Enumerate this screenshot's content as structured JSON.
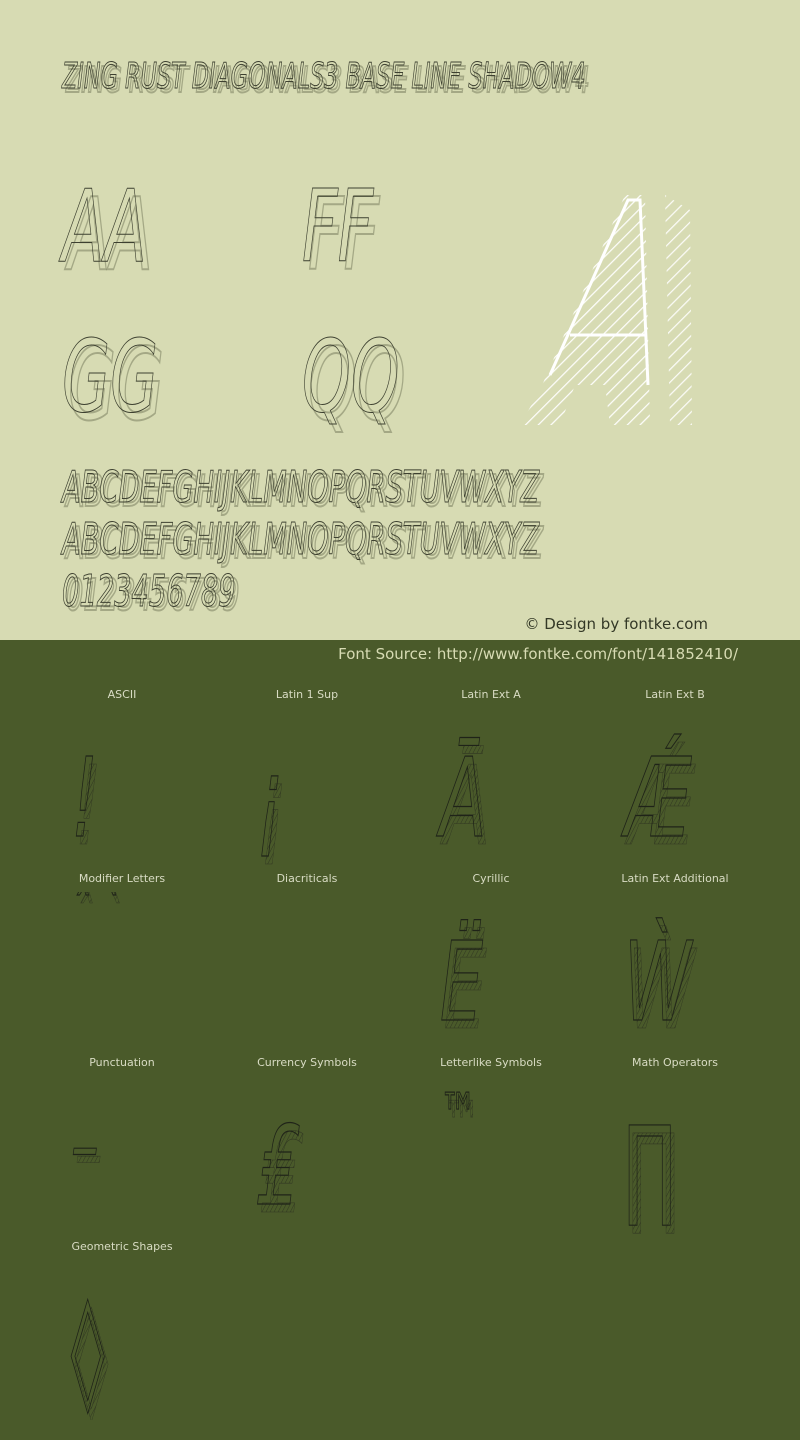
{
  "header": {
    "font_title": "ZING RUST DIAGONALS3 BASE LINE SHADOW4"
  },
  "preview": {
    "pairs": [
      "AA",
      "FF",
      "GG",
      "QQ"
    ],
    "feature_glyph": "A",
    "uppercase_line1": "ABCDEFGHIJKLMNOPQRSTUVWXYZ",
    "uppercase_line2": "ABCDEFGHIJKLMNOPQRSTUVWXYZ",
    "digits": "0123456789"
  },
  "credit": "© Design by fontke.com",
  "source": "Font Source: http://www.fontke.com/font/141852410/",
  "colors": {
    "top_bg": "#d7dbb3",
    "bottom_bg": "#4a5a2a",
    "glyph_stroke": "#1f2318",
    "white_glyph": "#ffffff"
  },
  "blocks": [
    {
      "label": "ASCII",
      "glyph": "!"
    },
    {
      "label": "Latin 1 Sup",
      "glyph": "¡"
    },
    {
      "label": "Latin Ext A",
      "glyph": "Ā"
    },
    {
      "label": "Latin Ext B",
      "glyph": "Ǽ"
    },
    {
      "label": "Modifier Letters",
      "glyph": "ˆ ˋ"
    },
    {
      "label": "Diacriticals",
      "glyph": ""
    },
    {
      "label": "Cyrillic",
      "glyph": "Ё"
    },
    {
      "label": "Latin Ext Additional",
      "glyph": "Ẁ"
    },
    {
      "label": "Punctuation",
      "glyph": "–"
    },
    {
      "label": "Currency Symbols",
      "glyph": "₤"
    },
    {
      "label": "Letterlike Symbols",
      "glyph": "™"
    },
    {
      "label": "Math Operators",
      "glyph": "∏"
    },
    {
      "label": "Geometric Shapes",
      "glyph": "◊"
    }
  ]
}
